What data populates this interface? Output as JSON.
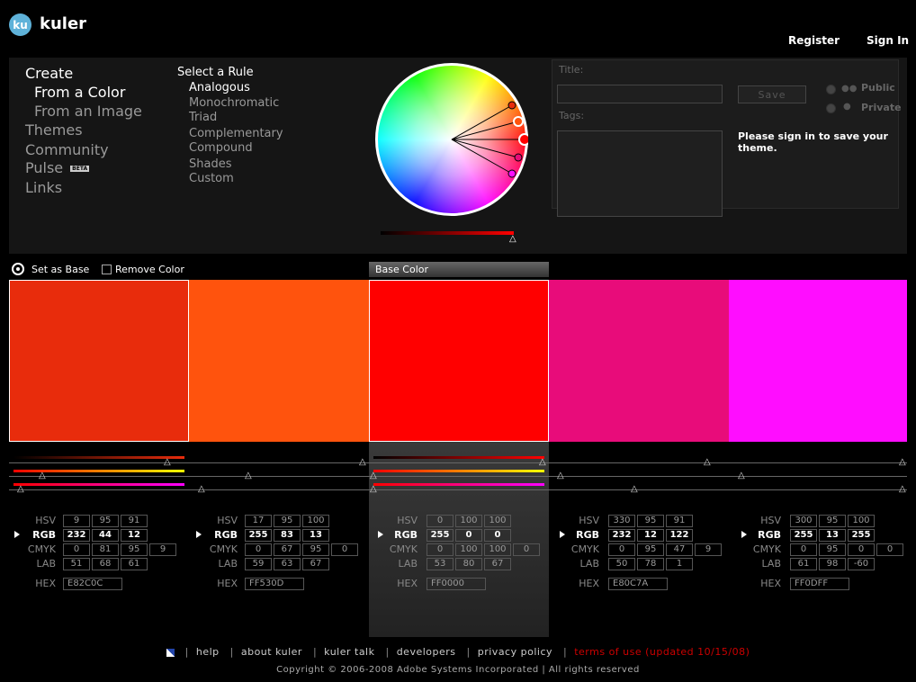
{
  "app": {
    "logo_text": "ku",
    "name": "kuler"
  },
  "topnav": {
    "register": "Register",
    "signin": "Sign In"
  },
  "nav": {
    "create": "Create",
    "from_color": "From a Color",
    "from_image": "From an Image",
    "themes": "Themes",
    "community": "Community",
    "pulse": "Pulse",
    "pulse_badge": "BETA",
    "links": "Links"
  },
  "rules": {
    "heading": "Select a Rule",
    "items": [
      "Analogous",
      "Monochromatic",
      "Triad",
      "Complementary",
      "Compound",
      "Shades",
      "Custom"
    ],
    "selected": "Analogous"
  },
  "form": {
    "title_label": "Title:",
    "tags_label": "Tags:",
    "save": "Save",
    "public": "Public",
    "private": "Private",
    "signin_msg": "Please sign in to save your theme."
  },
  "toolbar": {
    "set_base": "Set as Base",
    "remove_color": "Remove Color",
    "base_color": "Base Color"
  },
  "swatches": [
    {
      "color": "#E82C0C",
      "hsv": [
        "9",
        "95",
        "91"
      ],
      "rgb": [
        "232",
        "44",
        "12"
      ],
      "cmyk": [
        "0",
        "81",
        "95",
        "9"
      ],
      "lab": [
        "51",
        "68",
        "61"
      ],
      "hex": "E82C0C"
    },
    {
      "color": "#FF530D",
      "hsv": [
        "17",
        "95",
        "100"
      ],
      "rgb": [
        "255",
        "83",
        "13"
      ],
      "cmyk": [
        "0",
        "67",
        "95",
        "0"
      ],
      "lab": [
        "59",
        "63",
        "67"
      ],
      "hex": "FF530D"
    },
    {
      "color": "#FF0000",
      "hsv": [
        "0",
        "100",
        "100"
      ],
      "rgb": [
        "255",
        "0",
        "0"
      ],
      "cmyk": [
        "0",
        "100",
        "100",
        "0"
      ],
      "lab": [
        "53",
        "80",
        "67"
      ],
      "hex": "FF0000"
    },
    {
      "color": "#E80C7A",
      "hsv": [
        "330",
        "95",
        "91"
      ],
      "rgb": [
        "232",
        "12",
        "122"
      ],
      "cmyk": [
        "0",
        "95",
        "47",
        "9"
      ],
      "lab": [
        "50",
        "78",
        "1"
      ],
      "hex": "E80C7A"
    },
    {
      "color": "#FF0DFF",
      "hsv": [
        "300",
        "95",
        "100"
      ],
      "rgb": [
        "255",
        "13",
        "255"
      ],
      "cmyk": [
        "0",
        "95",
        "0",
        "0"
      ],
      "lab": [
        "61",
        "98",
        "-60"
      ],
      "hex": "FF0DFF"
    }
  ],
  "row_labels": {
    "hsv": "HSV",
    "rgb": "RGB",
    "cmyk": "CMYK",
    "lab": "LAB",
    "hex": "HEX"
  },
  "footer": {
    "links": [
      "help",
      "about kuler",
      "kuler talk",
      "developers",
      "privacy policy"
    ],
    "terms": "terms of use (updated 10/15/08)",
    "copyright": "Copyright © 2006-2008 Adobe Systems Incorporated | All rights reserved"
  },
  "colors": {
    "terms": "#cc0000",
    "panel": "#151515",
    "accent": "#5fb2d9"
  }
}
